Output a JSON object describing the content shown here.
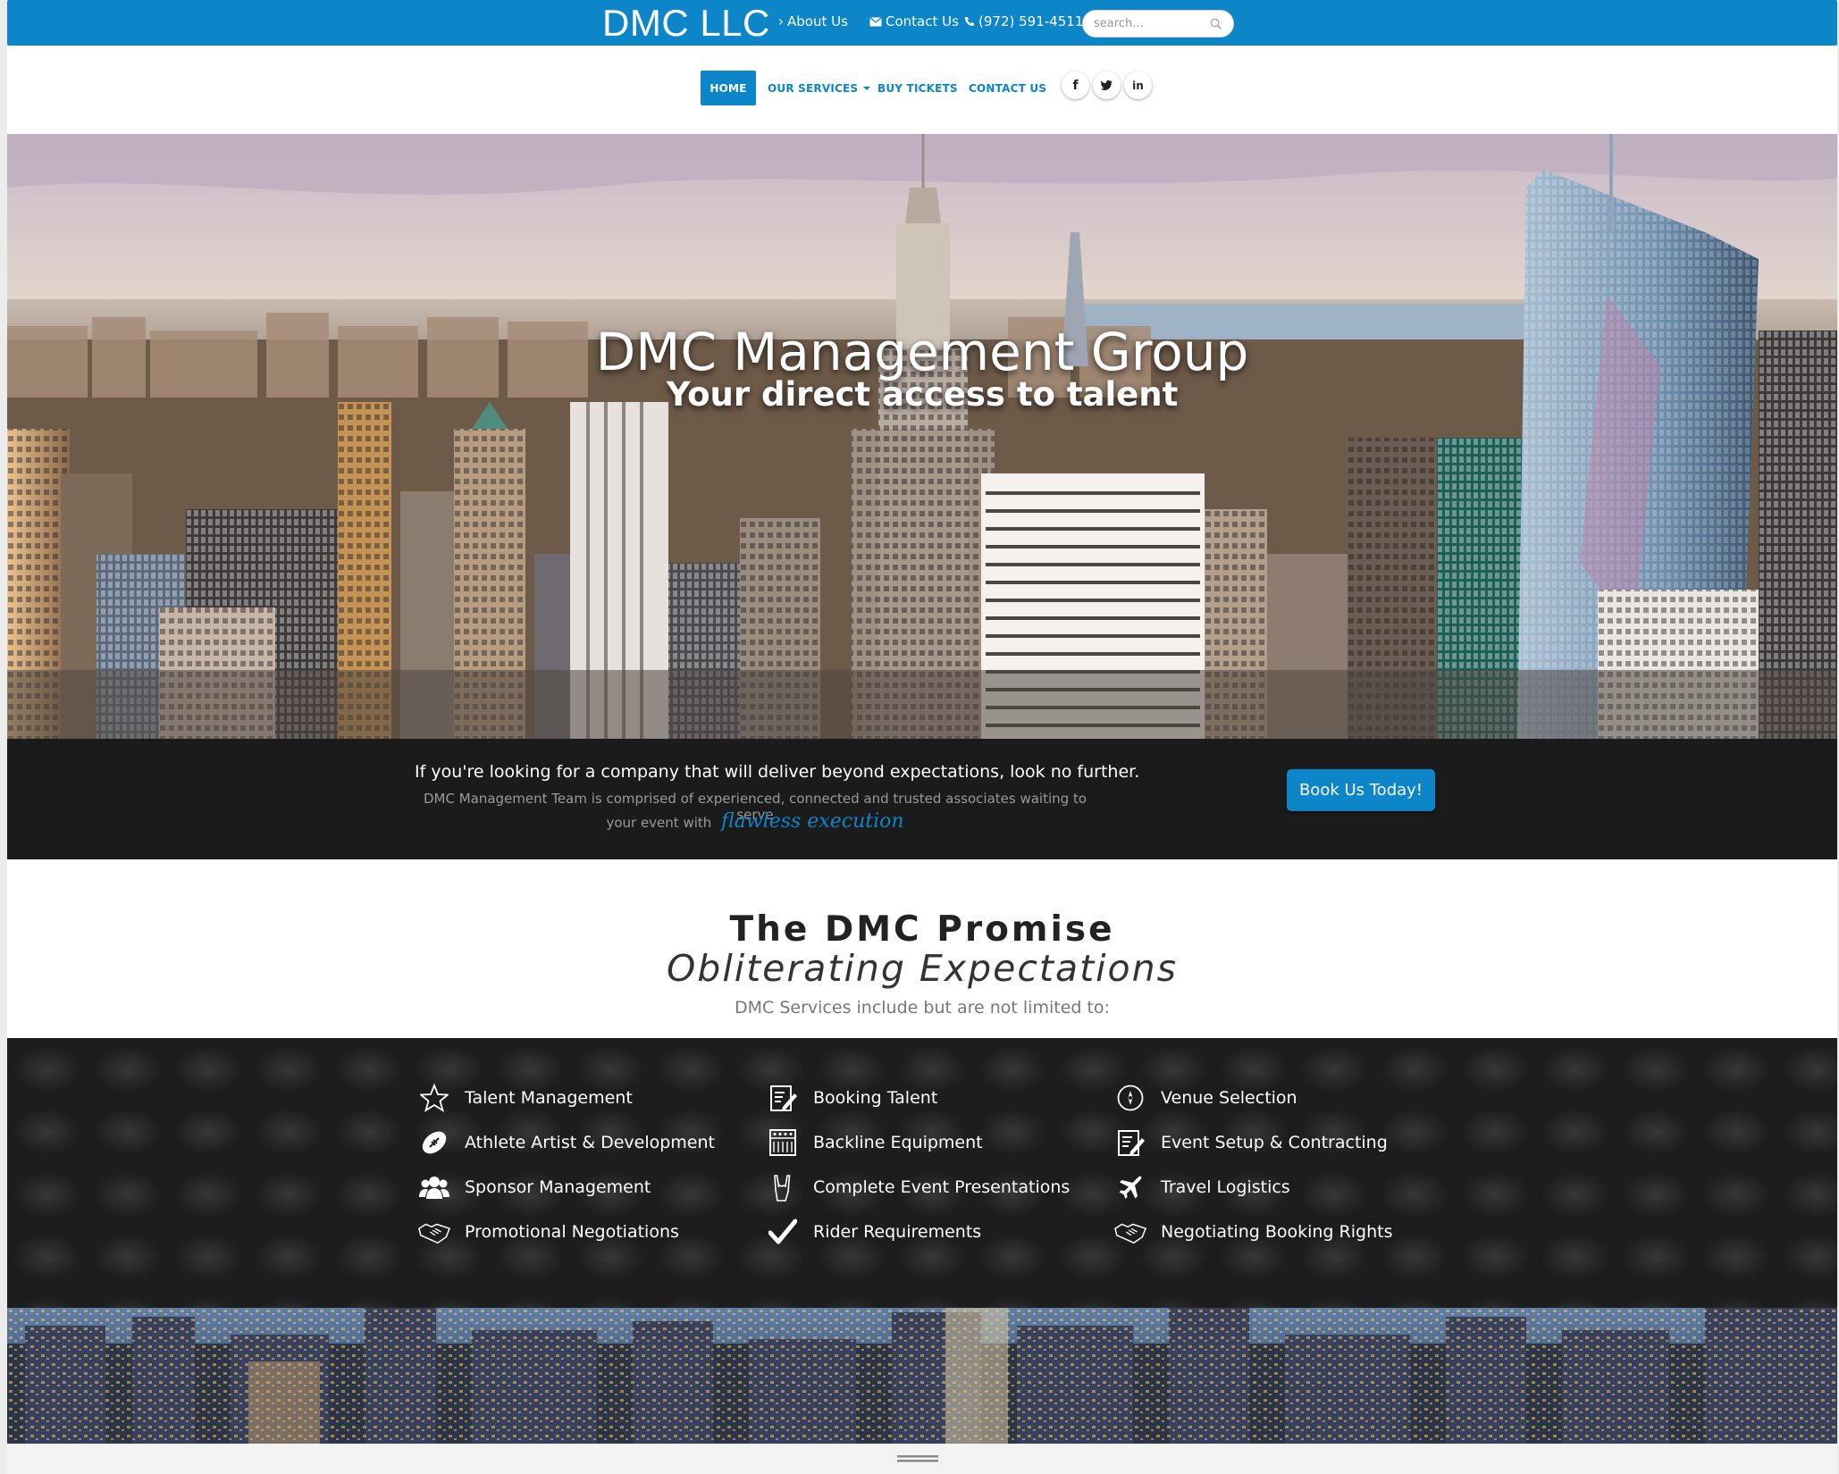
{
  "topbar": {
    "brand": "DMC LLC",
    "about_label": "About Us",
    "contact_label": "Contact Us",
    "phone_label": "(972) 591-4511",
    "search_placeholder": "search..."
  },
  "nav": {
    "items": [
      {
        "label": "HOME",
        "active": true
      },
      {
        "label": "OUR SERVICES",
        "dropdown": true
      },
      {
        "label": "BUY TICKETS"
      },
      {
        "label": "CONTACT US"
      }
    ],
    "social": [
      {
        "icon": "facebook-icon",
        "glyph": "f"
      },
      {
        "icon": "twitter-icon",
        "glyph": "t"
      },
      {
        "icon": "linkedin-icon",
        "glyph": "in"
      }
    ]
  },
  "hero": {
    "title": "DMC Management Group",
    "subtitle": "Your direct access to talent"
  },
  "cta": {
    "lead": "If you're looking for a company that will deliver beyond expectations, look no further.",
    "desc_line1": "DMC Management Team is comprised of experienced, connected and trusted associates waiting to serve",
    "desc_line2": "your event with",
    "highlight": "flawless execution",
    "button": "Book Us Today!"
  },
  "promise": {
    "title": "The DMC Promise",
    "subtitle": "Obliterating Expectations",
    "note": "DMC Services include but are not limited to:"
  },
  "services": [
    [
      "Talent Management",
      "Athlete Artist & Development",
      "Sponsor Management",
      "Promotional Negotiations"
    ],
    [
      "Booking Talent",
      "Backline Equipment",
      "Complete Event Presentations",
      "Rider Requirements"
    ],
    [
      "Venue Selection",
      "Event Setup & Contracting",
      "Travel Logistics",
      "Negotiating Booking Rights"
    ]
  ],
  "colors": {
    "brand_blue": "#0c85c9",
    "dark_band": "#1b1b1b"
  }
}
